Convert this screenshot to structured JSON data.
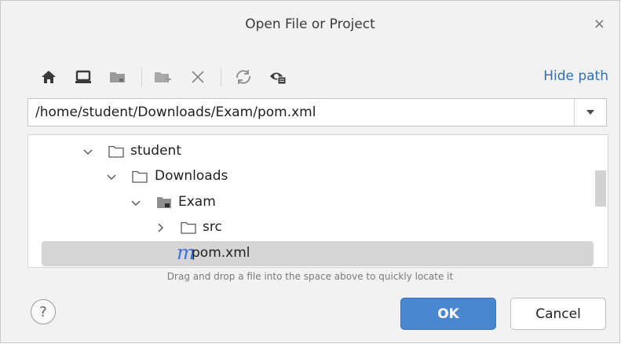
{
  "dialog": {
    "title": "Open File or Project",
    "close_glyph": "×"
  },
  "toolbar": {
    "icons": [
      "home-icon",
      "desktop-icon",
      "project-folder-icon",
      "new-folder-icon",
      "delete-icon",
      "refresh-icon",
      "show-hidden-icon"
    ],
    "hide_path_label": "Hide path"
  },
  "path": {
    "value": "/home/student/Downloads/Exam/pom.xml"
  },
  "tree": {
    "rows": [
      {
        "label": "student",
        "expanded": true
      },
      {
        "label": "Downloads",
        "expanded": true
      },
      {
        "label": "Exam",
        "expanded": true
      },
      {
        "label": "src",
        "expanded": false
      },
      {
        "label": "pom.xml",
        "selected": true,
        "file_glyph": "m"
      }
    ]
  },
  "hint": "Drag and drop a file into the space above to quickly locate it",
  "buttons": {
    "help": "?",
    "ok": "OK",
    "cancel": "Cancel"
  },
  "colors": {
    "accent": "#4a86d0",
    "link": "#2f6fb7",
    "maven_icon": "#3d6fdc",
    "selection": "#d5d5d5"
  }
}
